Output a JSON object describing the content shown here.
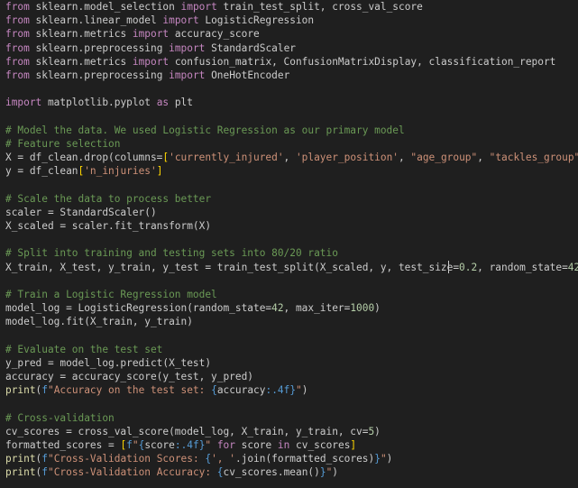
{
  "editor": {
    "lines": [
      [
        [
          "kw",
          "from"
        ],
        [
          "plain",
          " sklearn.model_selection "
        ],
        [
          "kw",
          "import"
        ],
        [
          "plain",
          " train_test_split, cross_val_score"
        ]
      ],
      [
        [
          "kw",
          "from"
        ],
        [
          "plain",
          " sklearn.linear_model "
        ],
        [
          "kw",
          "import"
        ],
        [
          "plain",
          " LogisticRegression"
        ]
      ],
      [
        [
          "kw",
          "from"
        ],
        [
          "plain",
          " sklearn.metrics "
        ],
        [
          "kw",
          "import"
        ],
        [
          "plain",
          " accuracy_score"
        ]
      ],
      [
        [
          "kw",
          "from"
        ],
        [
          "plain",
          " sklearn.preprocessing "
        ],
        [
          "kw",
          "import"
        ],
        [
          "plain",
          " StandardScaler"
        ]
      ],
      [
        [
          "kw",
          "from"
        ],
        [
          "plain",
          " sklearn.metrics "
        ],
        [
          "kw",
          "import"
        ],
        [
          "plain",
          " confusion_matrix, ConfusionMatrixDisplay, classification_report"
        ]
      ],
      [
        [
          "kw",
          "from"
        ],
        [
          "plain",
          " sklearn.preprocessing "
        ],
        [
          "kw",
          "import"
        ],
        [
          "plain",
          " OneHotEncoder"
        ]
      ],
      [],
      [
        [
          "kw",
          "import"
        ],
        [
          "plain",
          " matplotlib.pyplot "
        ],
        [
          "kw",
          "as"
        ],
        [
          "plain",
          " plt"
        ]
      ],
      [],
      [
        [
          "cm",
          "# Model the data. We used Logistic Regression as our primary model"
        ]
      ],
      [
        [
          "cm",
          "# Feature selection"
        ]
      ],
      [
        [
          "plain",
          "X = df_clean.drop(columns="
        ],
        [
          "br",
          "["
        ],
        [
          "str",
          "'currently_injured'"
        ],
        [
          "plain",
          ", "
        ],
        [
          "str",
          "'player_position'"
        ],
        [
          "plain",
          ", "
        ],
        [
          "str",
          "\"age_group\""
        ],
        [
          "plain",
          ", "
        ],
        [
          "str",
          "\"tackles_group\""
        ],
        [
          "br",
          "]"
        ],
        [
          "plain",
          ")"
        ]
      ],
      [
        [
          "plain",
          "y = df_clean"
        ],
        [
          "br",
          "["
        ],
        [
          "str",
          "'n_injuries'"
        ],
        [
          "br",
          "]"
        ]
      ],
      [],
      [
        [
          "cm",
          "# Scale the data to process better"
        ]
      ],
      [
        [
          "plain",
          "scaler = StandardScaler()"
        ]
      ],
      [
        [
          "plain",
          "X_scaled = scaler.fit_transform(X)"
        ]
      ],
      [],
      [
        [
          "cm",
          "# Split into training and testing sets into 80/20 ratio"
        ]
      ],
      [
        [
          "plain",
          "X_train, X_test, y_train, y_test = train_test_split(X_scaled, y, test_size="
        ],
        [
          "num",
          "0.2"
        ],
        [
          "plain",
          ", random_state="
        ],
        [
          "num",
          "42"
        ],
        [
          "plain",
          ")"
        ]
      ],
      [],
      [
        [
          "cm",
          "# Train a Logistic Regression model"
        ]
      ],
      [
        [
          "plain",
          "model_log = LogisticRegression(random_state="
        ],
        [
          "num",
          "42"
        ],
        [
          "plain",
          ", max_iter="
        ],
        [
          "num",
          "1000"
        ],
        [
          "plain",
          ")"
        ]
      ],
      [
        [
          "plain",
          "model_log.fit(X_train, y_train)"
        ]
      ],
      [],
      [
        [
          "cm",
          "# Evaluate on the test set"
        ]
      ],
      [
        [
          "plain",
          "y_pred = model_log.predict(X_test)"
        ]
      ],
      [
        [
          "plain",
          "accuracy = accuracy_score(y_test, y_pred)"
        ]
      ],
      [
        [
          "fn",
          "print"
        ],
        [
          "plain",
          "("
        ],
        [
          "fmt",
          "f"
        ],
        [
          "str",
          "\"Accuracy on the test set: "
        ],
        [
          "fmt",
          "{"
        ],
        [
          "plain",
          "accuracy"
        ],
        [
          "fmt",
          ":.4f}"
        ],
        [
          "str",
          "\""
        ],
        [
          "plain",
          ")"
        ]
      ],
      [],
      [
        [
          "cm",
          "# Cross-validation"
        ]
      ],
      [
        [
          "plain",
          "cv_scores = cross_val_score(model_log, X_train, y_train, cv="
        ],
        [
          "num",
          "5"
        ],
        [
          "plain",
          ")"
        ]
      ],
      [
        [
          "plain",
          "formatted_scores = "
        ],
        [
          "br",
          "["
        ],
        [
          "fmt",
          "f"
        ],
        [
          "str",
          "\""
        ],
        [
          "fmt",
          "{"
        ],
        [
          "plain",
          "score"
        ],
        [
          "fmt",
          ":.4f}"
        ],
        [
          "str",
          "\""
        ],
        [
          "plain",
          " "
        ],
        [
          "kw",
          "for"
        ],
        [
          "plain",
          " score "
        ],
        [
          "kw",
          "in"
        ],
        [
          "plain",
          " cv_scores"
        ],
        [
          "br",
          "]"
        ]
      ],
      [
        [
          "fn",
          "print"
        ],
        [
          "plain",
          "("
        ],
        [
          "fmt",
          "f"
        ],
        [
          "str",
          "\"Cross-Validation Scores: "
        ],
        [
          "fmt",
          "{"
        ],
        [
          "str",
          "', '"
        ],
        [
          "plain",
          ".join(formatted_scores)"
        ],
        [
          "fmt",
          "}"
        ],
        [
          "str",
          "\""
        ],
        [
          "plain",
          ")"
        ]
      ],
      [
        [
          "fn",
          "print"
        ],
        [
          "plain",
          "("
        ],
        [
          "fmt",
          "f"
        ],
        [
          "str",
          "\"Cross-Validation Accuracy: "
        ],
        [
          "fmt",
          "{"
        ],
        [
          "plain",
          "cv_scores.mean()"
        ],
        [
          "fmt",
          "}"
        ],
        [
          "str",
          "\""
        ],
        [
          "plain",
          ")"
        ]
      ]
    ]
  }
}
